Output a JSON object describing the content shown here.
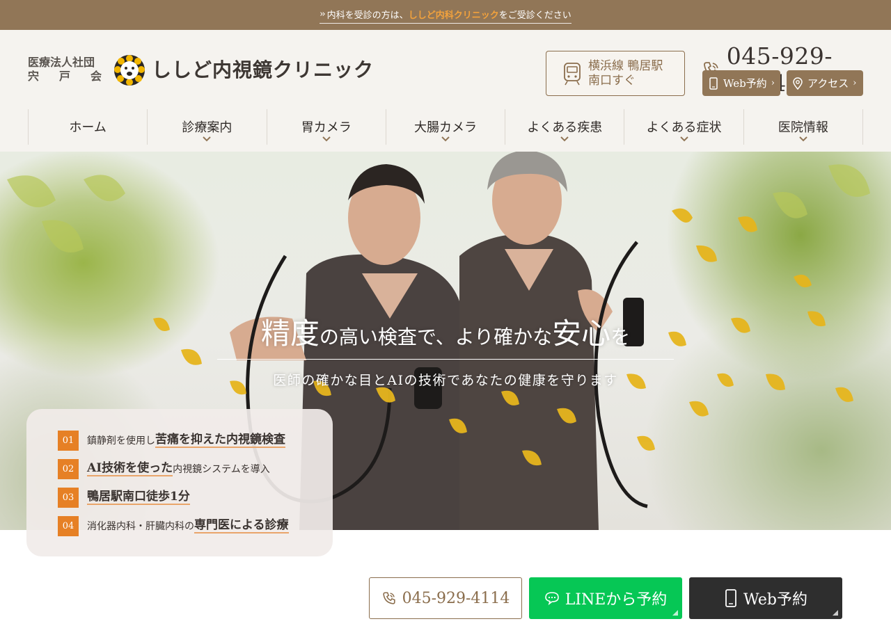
{
  "topbar": {
    "prefix": "内科を受診の方は、",
    "link": "ししど内科クリニック",
    "suffix": "をご受診ください"
  },
  "header": {
    "corp_line1": "医療法人社団",
    "corp_line2": [
      "宍",
      "戸",
      "会"
    ],
    "clinic_name": "ししど内視鏡クリニック",
    "station_line1": "横浜線 鴨居駅",
    "station_line2": "南口すぐ",
    "phone": "045-929-4114",
    "web_label": "Web予約",
    "access_label": "アクセス"
  },
  "nav": {
    "items": [
      {
        "label": "ホーム",
        "dropdown": false
      },
      {
        "label": "診療案内",
        "dropdown": true
      },
      {
        "label": "胃カメラ",
        "dropdown": true
      },
      {
        "label": "大腸カメラ",
        "dropdown": true
      },
      {
        "label": "よくある疾患",
        "dropdown": true
      },
      {
        "label": "よくある症状",
        "dropdown": true
      },
      {
        "label": "医院情報",
        "dropdown": true
      }
    ]
  },
  "hero": {
    "title_a": "精度",
    "title_b": "の高い検査で、より確かな",
    "title_c": "安心",
    "title_d": "を",
    "subtitle": "医師の確かな目とAIの技術であなたの健康を守ります"
  },
  "features": [
    {
      "no": "01",
      "pre": "鎮静剤を使用し",
      "em": "苦痛を抑えた内視鏡検査",
      "post": ""
    },
    {
      "no": "02",
      "pre": "",
      "em": "AI技術を使った",
      "post": "内視鏡システムを導入"
    },
    {
      "no": "03",
      "pre": "",
      "em": "鴨居駅南口徒歩1分",
      "post": ""
    },
    {
      "no": "04",
      "pre": "消化器内科・肝臓内科の",
      "em": "専門医による診療",
      "post": ""
    }
  ],
  "cta": {
    "tel": "045-929-4114",
    "line": "LINEから予約",
    "web": "Web予約"
  },
  "colors": {
    "brand_brown": "#917657",
    "accent_orange": "#e68025",
    "line_green": "#06c755",
    "dark": "#2e2e2e"
  }
}
